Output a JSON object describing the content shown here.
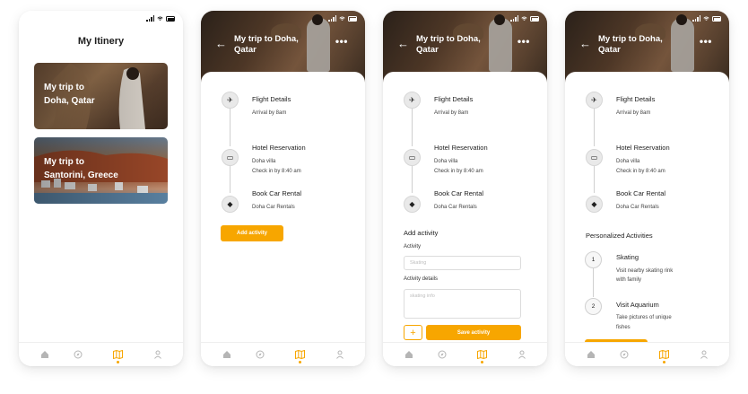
{
  "screen1": {
    "title": "My Itinery",
    "trips": [
      {
        "line1": "My trip to",
        "line2": "Doha, Qatar"
      },
      {
        "line1": "My trip to",
        "line2": "Santorini, Greece"
      }
    ]
  },
  "trip": {
    "title_line1": "My trip to Doha,",
    "title_line2": "Qatar",
    "more": "•••",
    "back": "←",
    "timeline": [
      {
        "icon": "airplane-icon",
        "glyph": "✈",
        "title": "Flight Details",
        "lines": [
          "Arrival by 8am"
        ]
      },
      {
        "icon": "bed-icon",
        "glyph": "▭",
        "title": "Hotel Reservation",
        "lines": [
          "Doha villa",
          "Check in by 8:40 am"
        ]
      },
      {
        "icon": "car-icon",
        "glyph": "◆",
        "title": "Book Car Rental",
        "lines": [
          "Doha Car Rentals"
        ]
      }
    ]
  },
  "screen2": {
    "add_button": "Add activity"
  },
  "screen3": {
    "section": "Add activity",
    "activity_label": "Activity",
    "activity_placeholder": "Skating",
    "details_label": "Activity details",
    "details_placeholder": "skating info",
    "plus": "+",
    "save_button": "Save activity"
  },
  "screen4": {
    "section": "Personalized Activities",
    "items": [
      {
        "num": "1",
        "title": "Skating",
        "lines": [
          "Visit nearby skating rink",
          "with family"
        ]
      },
      {
        "num": "2",
        "title": "Visit Aquarium",
        "lines": [
          "Take pictures of unique",
          "fishes"
        ]
      }
    ]
  },
  "accent": "#F7A600"
}
